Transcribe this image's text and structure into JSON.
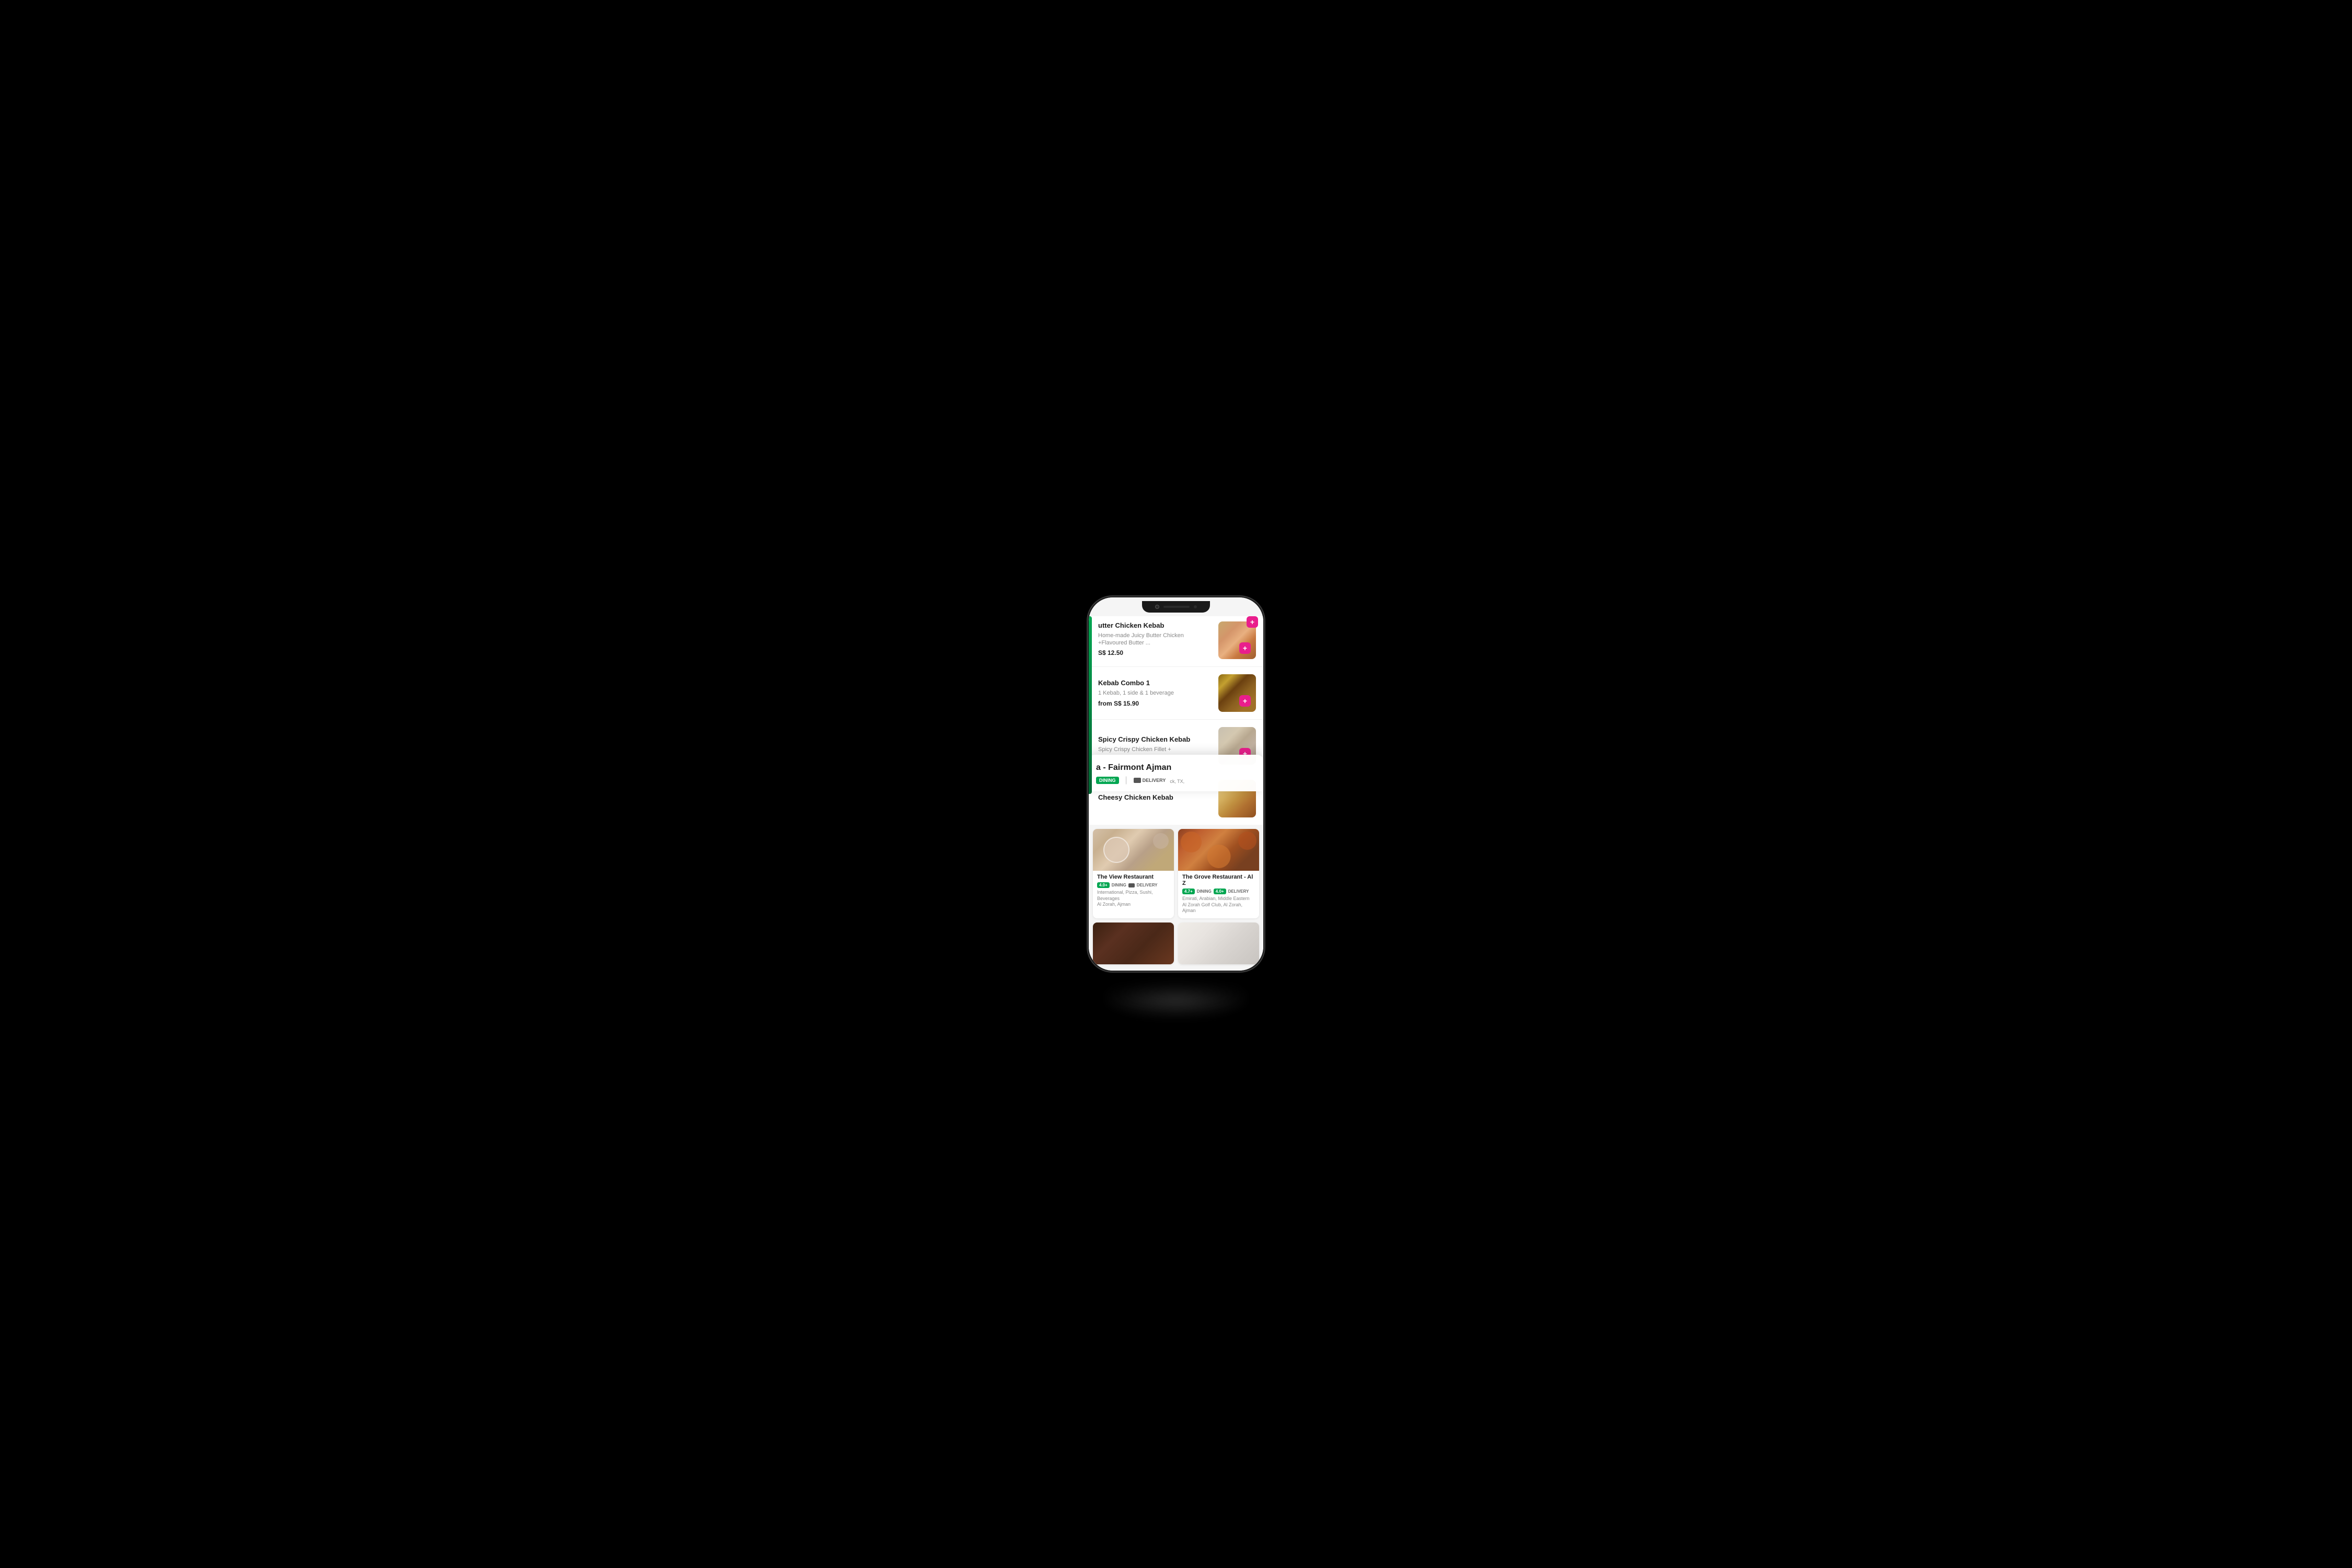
{
  "phone": {
    "notch": {
      "aria": "phone-notch"
    }
  },
  "menu": {
    "items": [
      {
        "id": "butter-chicken-kebab",
        "name": "Butter Chicken Kebab",
        "name_partial": "utter Chicken Kebab",
        "description": "Home-made Juicy Butter Chicken +Flavoured Butter ...",
        "price": "S$ 12.50",
        "has_add_button": true
      },
      {
        "id": "kebab-combo-1",
        "name": "Kebab Combo 1",
        "description": "1 Kebab, 1 side & 1 beverage",
        "price": "from S$ 15.90",
        "has_add_button": true
      },
      {
        "id": "spicy-crispy-chicken-kebab",
        "name": "Spicy Crispy Chicken Kebab",
        "description": "Spicy Crispy Chicken Fillet +",
        "price": "",
        "has_add_button": true
      },
      {
        "id": "cheesy-chicken-kebab",
        "name": "Cheesy Chicken Kebab",
        "description": "",
        "price": "",
        "has_add_button": false
      }
    ]
  },
  "popup": {
    "restaurant_name": "a - Fairmont Ajman",
    "dining_label": "DINING",
    "delivery_label": "DELIVERY",
    "location": "ck, TX,",
    "pipe": "|"
  },
  "restaurants": [
    {
      "id": "the-view-restaurant",
      "name": "The View Restaurant",
      "rating_dining": "4.0+",
      "rating_delivery": "",
      "dining_label": "DINING",
      "delivery_label": "DELIVERY",
      "cuisine": "International, Pizza, Sushi, Beverages",
      "location": "Al Zorah, Ajman",
      "has_delivery": true
    },
    {
      "id": "the-grove-restaurant",
      "name": "The Grove Restaurant - Al Z",
      "rating_dining": "4.7+",
      "rating_delivery": "4.0+",
      "dining_label": "DINING",
      "delivery_label": "DELIVERY",
      "cuisine": "Emirati, Arabian, Middle Eastern",
      "location": "Al Zorah Golf Club, Al Zorah, Ajman",
      "has_delivery": true
    },
    {
      "id": "bottom-left-restaurant",
      "name": "",
      "rating_dining": "",
      "cuisine": "",
      "location": ""
    },
    {
      "id": "bottom-right-restaurant",
      "name": "",
      "rating_dining": "",
      "cuisine": "",
      "location": ""
    }
  ],
  "icons": {
    "plus": "+",
    "pipe": "|",
    "delivery_car": "🚗"
  },
  "colors": {
    "accent_green": "#00a651",
    "accent_pink": "#e91e8c",
    "text_dark": "#1a1a1a",
    "text_gray": "#888888",
    "bg_light": "#f5f5f5",
    "white": "#ffffff"
  }
}
